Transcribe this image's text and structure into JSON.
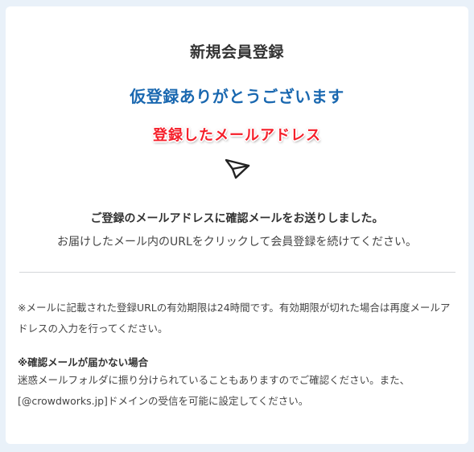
{
  "title": "新規会員登録",
  "thanks": "仮登録ありがとうございます",
  "email_label": "登録したメールアドレス",
  "icon": "send-paper-plane-icon",
  "sent_message": "ご登録のメールアドレスに確認メールをお送りしました。",
  "instruction": "お届けしたメール内のURLをクリックして会員登録を続けてください。",
  "notes": {
    "expiry": "※メールに記載された登録URLの有効期限は24時間です。有効期限が切れた場合は再度メールアドレスの入力を行ってください。",
    "not_received_heading": "※確認メールが届かない場合",
    "not_received_body": "迷惑メールフォルダに振り分けられていることもありますのでご確認ください。また、[@crowdworks.jp]ドメインの受信を可能に設定してください。"
  },
  "colors": {
    "background": "#e9f1f9",
    "card": "#ffffff",
    "accent_blue": "#1a68b0",
    "email_label_red": "#f51f2a",
    "text": "#333333",
    "divider": "#d4d7da"
  }
}
